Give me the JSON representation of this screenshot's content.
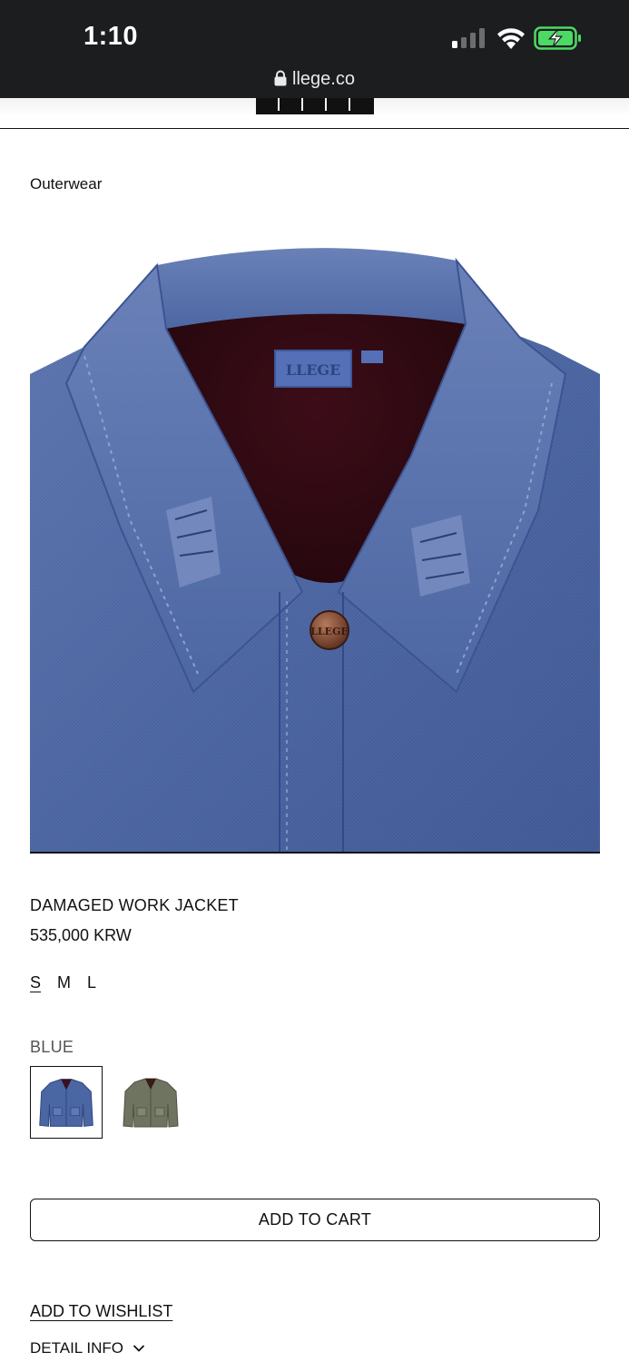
{
  "status_bar": {
    "time": "1:10",
    "icons": [
      "cellular-signal-icon",
      "wifi-icon",
      "battery-charging-icon"
    ],
    "battery_color": "#4cd964"
  },
  "browser": {
    "url": "llege.co",
    "lock_icon": "lock-icon"
  },
  "header": {
    "logo_icon": "llege-logo"
  },
  "breadcrumb": "Outerwear",
  "product": {
    "image_icon": "denim-jacket-collar-photo",
    "name": "DAMAGED WORK JACKET",
    "price": "535,000 KRW",
    "sizes": [
      {
        "label": "S",
        "selected": true
      },
      {
        "label": "M",
        "selected": false
      },
      {
        "label": "L",
        "selected": false
      }
    ],
    "color_label": "BLUE",
    "swatches": [
      {
        "name": "blue",
        "color": "#4a66a3",
        "selected": true
      },
      {
        "name": "olive",
        "color": "#6f7460",
        "selected": false
      }
    ]
  },
  "actions": {
    "add_to_cart": "ADD TO CART",
    "add_to_wishlist": "ADD TO WISHLIST",
    "detail_info": "DETAIL INFO",
    "detail_icon": "chevron-down-icon"
  }
}
